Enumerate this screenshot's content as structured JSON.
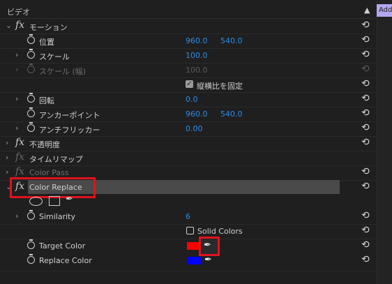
{
  "header": {
    "title": "ビデオ",
    "collapse_icon": "triangle-up-icon"
  },
  "add_badge": "Add",
  "motion": {
    "label": "モーション"
  },
  "position": {
    "label": "位置",
    "x": "960.0",
    "y": "540.0"
  },
  "scale": {
    "label": "スケール",
    "value": "100.0"
  },
  "scale_width": {
    "label": "スケール (幅)",
    "value": "100.0"
  },
  "uniform_scale": {
    "label": "縦横比を固定",
    "checked": true
  },
  "rotation": {
    "label": "回転",
    "value": "0.0"
  },
  "anchor": {
    "label": "アンカーポイント",
    "x": "960.0",
    "y": "540.0"
  },
  "anti_flicker": {
    "label": "アンチフリッカー",
    "value": "0.00"
  },
  "opacity": {
    "label": "不透明度"
  },
  "time_remap": {
    "label": "タイムリマップ"
  },
  "color_pass": {
    "label": "Color Pass"
  },
  "color_replace": {
    "label": "Color Replace"
  },
  "similarity": {
    "label": "Similarity",
    "value": "6"
  },
  "solid_colors": {
    "label": "Solid Colors",
    "checked": false
  },
  "target_color": {
    "label": "Target Color",
    "color": "#ff0000"
  },
  "replace_color": {
    "label": "Replace Color",
    "color": "#0000ff"
  },
  "colors": {
    "accent_value": "#2d8ceb",
    "highlight_box": "#e0121c"
  }
}
